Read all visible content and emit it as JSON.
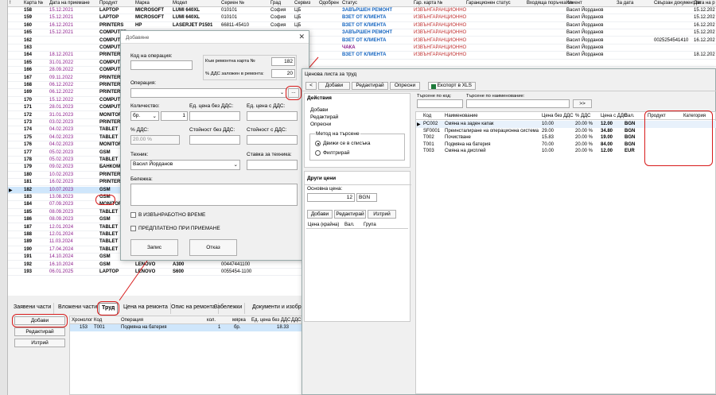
{
  "grid": {
    "headers": [
      "!",
      "Карта №",
      "Дата на приемане",
      "Продукт",
      "Марка",
      "Модел",
      "Сериен №",
      "Град",
      "Сервиз",
      "Одобрен",
      "Статус",
      "Гар. карта №",
      "Гаранционен статус",
      "Входяща поръчка №",
      "Клиент",
      "За дата",
      "Свързан документ №",
      "Дата на р"
    ],
    "rows": [
      {
        "n": "158",
        "d": "15.12.2021",
        "p": "LAPTOP",
        "m": "MICROSOFT",
        "mo": "LUMI 640XL",
        "s": "010101",
        "c": "София",
        "sv": "ЦБ",
        "st": "ЗАВЪРШЕН РЕМОНТ",
        "stc": "blue",
        "w": "ИЗВЪНГАРАНЦИОННО",
        "cl": "Васил Йорданов",
        "f": "",
        "dr": "15.12.202"
      },
      {
        "n": "159",
        "d": "15.12.2021",
        "p": "LAPTOP",
        "m": "MICROSOFT",
        "mo": "LUMI 640XL",
        "s": "010101",
        "c": "София",
        "sv": "ЦБ",
        "st": "ВЗЕТ ОТ КЛИЕНТА",
        "stc": "blue",
        "w": "ИЗВЪНГАРАНЦИОННО",
        "cl": "Васил Йорданов",
        "f": "",
        "dr": "15.12.202"
      },
      {
        "n": "160",
        "d": "16.12.2021",
        "p": "PRINTERS",
        "m": "HP",
        "mo": "LASERJET P1501",
        "s": "66811-45410",
        "c": "София",
        "sv": "ЦБ",
        "st": "ВЗЕТ ОТ КЛИЕНТА",
        "stc": "blue",
        "w": "ИЗВЪНГАРАНЦИОННО",
        "cl": "Васил Йорданов",
        "f": "",
        "dr": "16.12.202"
      },
      {
        "n": "165",
        "d": "15.12.2021",
        "p": "COMPUTER",
        "m": "",
        "mo": "",
        "s": "",
        "c": "",
        "sv": "",
        "st": "ЗАВЪРШЕН РЕМОНТ",
        "stc": "blue",
        "w": "ИЗВЪНГАРАНЦИОННО",
        "cl": "Васил Йорданов",
        "f": "",
        "dr": "15.12.202"
      },
      {
        "n": "162",
        "d": "",
        "p": "COMPUTER",
        "m": "",
        "mo": "",
        "s": "",
        "c": "",
        "sv": "",
        "st": "ВЗЕТ ОТ КЛИЕНТА",
        "stc": "blue",
        "w": "ИЗВЪНГАРАНЦИОННО",
        "cl": "Васил Йорданов",
        "f": "0025254541410",
        "dr": "16.12.202"
      },
      {
        "n": "163",
        "d": "",
        "p": "COMPUTER",
        "m": "",
        "mo": "",
        "s": "",
        "c": "",
        "sv": "",
        "st": "ЧАКА",
        "stc": "purple",
        "w": "ИЗВЪНГАРАНЦИОННО",
        "cl": "Васил Йорданов",
        "f": "",
        "dr": ""
      },
      {
        "n": "164",
        "d": "18.12.2021",
        "p": "PRINTER",
        "m": "",
        "mo": "",
        "s": "",
        "c": "",
        "sv": "",
        "st": "ВЗЕТ ОТ КЛИЕНТА",
        "stc": "blue",
        "w": "ИЗВЪНГАРАНЦИОННО",
        "cl": "Васил Йорданов",
        "f": "",
        "dr": "18.12.202"
      },
      {
        "n": "165",
        "d": "31.01.2022",
        "p": "COMPUTER",
        "m": "",
        "mo": "",
        "s": "",
        "c": "",
        "sv": "",
        "st": "",
        "stc": "blue",
        "w": "",
        "cl": "",
        "f": "",
        "dr": ""
      },
      {
        "n": "166",
        "d": "28.09.2022",
        "p": "COMPUTER",
        "m": "",
        "mo": "",
        "s": "",
        "c": "",
        "sv": "",
        "st": "",
        "stc": "blue",
        "w": "",
        "cl": "",
        "f": "",
        "dr": ""
      },
      {
        "n": "167",
        "d": "09.11.2022",
        "p": "PRINTER",
        "m": "",
        "mo": "",
        "s": "",
        "c": "",
        "sv": "",
        "st": "",
        "stc": "blue",
        "w": "",
        "cl": "",
        "f": "",
        "dr": ""
      },
      {
        "n": "168",
        "d": "06.12.2022",
        "p": "PRINTER",
        "m": "",
        "mo": "",
        "s": "",
        "c": "",
        "sv": "",
        "st": "",
        "stc": "blue",
        "w": "",
        "cl": "",
        "f": "",
        "dr": ""
      },
      {
        "n": "169",
        "d": "06.12.2022",
        "p": "PRINTER",
        "m": "",
        "mo": "",
        "s": "",
        "c": "",
        "sv": "",
        "st": "",
        "stc": "blue",
        "w": "",
        "cl": "",
        "f": "",
        "dr": ""
      },
      {
        "n": "170",
        "d": "15.12.2022",
        "p": "COMPUTER",
        "m": "",
        "mo": "",
        "s": "",
        "c": "",
        "sv": "",
        "st": "",
        "stc": "blue",
        "w": "",
        "cl": "",
        "f": "",
        "dr": ""
      },
      {
        "n": "171",
        "d": "28.01.2023",
        "p": "COMPUTER",
        "m": "",
        "mo": "",
        "s": "",
        "c": "",
        "sv": "",
        "st": "",
        "stc": "blue",
        "w": "",
        "cl": "",
        "f": "",
        "dr": ""
      },
      {
        "n": "172",
        "d": "31.01.2023",
        "p": "MONITOR",
        "m": "",
        "mo": "",
        "s": "",
        "c": "",
        "sv": "",
        "st": "",
        "stc": "blue",
        "w": "",
        "cl": "",
        "f": "",
        "dr": ""
      },
      {
        "n": "173",
        "d": "03.02.2023",
        "p": "PRINTER",
        "m": "",
        "mo": "",
        "s": "",
        "c": "",
        "sv": "",
        "st": "",
        "stc": "blue",
        "w": "",
        "cl": "",
        "f": "",
        "dr": ""
      },
      {
        "n": "174",
        "d": "04.02.2023",
        "p": "TABLET",
        "m": "",
        "mo": "",
        "s": "",
        "c": "",
        "sv": "",
        "st": "",
        "stc": "blue",
        "w": "",
        "cl": "",
        "f": "",
        "dr": ""
      },
      {
        "n": "175",
        "d": "04.02.2023",
        "p": "TABLET",
        "m": "",
        "mo": "",
        "s": "",
        "c": "",
        "sv": "",
        "st": "",
        "stc": "blue",
        "w": "",
        "cl": "",
        "f": "",
        "dr": ""
      },
      {
        "n": "176",
        "d": "04.02.2023",
        "p": "MONITOR",
        "m": "",
        "mo": "",
        "s": "",
        "c": "",
        "sv": "",
        "st": "",
        "stc": "blue",
        "w": "",
        "cl": "",
        "f": "",
        "dr": ""
      },
      {
        "n": "177",
        "d": "05.02.2023",
        "p": "GSM",
        "m": "",
        "mo": "",
        "s": "",
        "c": "",
        "sv": "",
        "st": "",
        "stc": "blue",
        "w": "",
        "cl": "",
        "f": "",
        "dr": ""
      },
      {
        "n": "178",
        "d": "05.02.2023",
        "p": "TABLET",
        "m": "",
        "mo": "",
        "s": "",
        "c": "",
        "sv": "",
        "st": "",
        "stc": "blue",
        "w": "",
        "cl": "",
        "f": "",
        "dr": ""
      },
      {
        "n": "179",
        "d": "09.02.2023",
        "p": "БАНКОМАТ",
        "m": "",
        "mo": "",
        "s": "",
        "c": "",
        "sv": "",
        "st": "",
        "stc": "blue",
        "w": "",
        "cl": "",
        "f": "",
        "dr": ""
      },
      {
        "n": "180",
        "d": "10.02.2023",
        "p": "PRINTER",
        "m": "",
        "mo": "",
        "s": "",
        "c": "",
        "sv": "",
        "st": "",
        "stc": "blue",
        "w": "",
        "cl": "",
        "f": "",
        "dr": ""
      },
      {
        "n": "181",
        "d": "16.02.2023",
        "p": "PRINTER",
        "m": "",
        "mo": "",
        "s": "",
        "c": "",
        "sv": "",
        "st": "",
        "stc": "blue",
        "w": "",
        "cl": "",
        "f": "",
        "dr": ""
      },
      {
        "n": "182",
        "d": "10.07.2023",
        "p": "GSM",
        "m": "",
        "mo": "",
        "s": "",
        "c": "",
        "sv": "",
        "st": "",
        "stc": "blue",
        "w": "",
        "cl": "",
        "f": "",
        "dr": ""
      },
      {
        "n": "183",
        "d": "13.08.2023",
        "p": "GSM",
        "m": "",
        "mo": "",
        "s": "",
        "c": "",
        "sv": "",
        "st": "",
        "stc": "blue",
        "w": "",
        "cl": "",
        "f": "",
        "dr": ""
      },
      {
        "n": "184",
        "d": "07.09.2023",
        "p": "MONITOR",
        "m": "",
        "mo": "",
        "s": "",
        "c": "",
        "sv": "",
        "st": "",
        "stc": "blue",
        "w": "",
        "cl": "",
        "f": "",
        "dr": ""
      },
      {
        "n": "185",
        "d": "08.09.2023",
        "p": "TABLET",
        "m": "",
        "mo": "",
        "s": "",
        "c": "",
        "sv": "",
        "st": "",
        "stc": "blue",
        "w": "",
        "cl": "",
        "f": "",
        "dr": ""
      },
      {
        "n": "186",
        "d": "08.09.2023",
        "p": "GSM",
        "m": "",
        "mo": "",
        "s": "",
        "c": "",
        "sv": "",
        "st": "",
        "stc": "blue",
        "w": "",
        "cl": "",
        "f": "",
        "dr": ""
      },
      {
        "n": "187",
        "d": "12.01.2024",
        "p": "TABLET",
        "m": "",
        "mo": "",
        "s": "",
        "c": "",
        "sv": "",
        "st": "",
        "stc": "blue",
        "w": "",
        "cl": "",
        "f": "",
        "dr": ""
      },
      {
        "n": "188",
        "d": "12.01.2024",
        "p": "TABLET",
        "m": "",
        "mo": "",
        "s": "",
        "c": "",
        "sv": "",
        "st": "",
        "stc": "blue",
        "w": "",
        "cl": "",
        "f": "",
        "dr": ""
      },
      {
        "n": "189",
        "d": "11.03.2024",
        "p": "TABLET",
        "m": "",
        "mo": "",
        "s": "",
        "c": "",
        "sv": "",
        "st": "",
        "stc": "blue",
        "w": "",
        "cl": "",
        "f": "",
        "dr": ""
      },
      {
        "n": "190",
        "d": "17.04.2024",
        "p": "TABLET",
        "m": "",
        "mo": "",
        "s": "",
        "c": "",
        "sv": "",
        "st": "",
        "stc": "blue",
        "w": "",
        "cl": "",
        "f": "",
        "dr": ""
      },
      {
        "n": "191",
        "d": "14.10.2024",
        "p": "GSM",
        "m": "",
        "mo": "",
        "s": "",
        "c": "",
        "sv": "",
        "st": "",
        "stc": "blue",
        "w": "",
        "cl": "",
        "f": "",
        "dr": ""
      },
      {
        "n": "192",
        "d": "16.10.2024",
        "p": "GSM",
        "m": "LENOVO",
        "mo": "A300",
        "s": "00447441100",
        "c": "",
        "sv": "",
        "st": "",
        "stc": "blue",
        "w": "",
        "cl": "",
        "f": "",
        "dr": ""
      },
      {
        "n": "193",
        "d": "06.01.2025",
        "p": "LAPTOP",
        "m": "LENOVO",
        "mo": "S600",
        "s": "0055454-1100",
        "c": "",
        "sv": "",
        "st": "",
        "stc": "blue",
        "w": "",
        "cl": "",
        "f": "",
        "dr": ""
      }
    ]
  },
  "bottom": {
    "tabs": [
      "Заявени части",
      "Вложени части",
      "Труд",
      "Цена на ремонта",
      "Опис на ремонта",
      "Забележки",
      "Документи и изобр"
    ],
    "add": "Добави",
    "edit": "Редактирай",
    "delete": "Изтрий",
    "headers": [
      "Хронолог",
      "Код",
      "Операция",
      "кол.",
      "мярка",
      "Ед. цена без ДДС",
      "ДДС"
    ],
    "row": [
      "153",
      "T001",
      "Подмяна на батерия",
      "1",
      "бр.",
      "18.33"
    ]
  },
  "dlg1": {
    "title": "Добавяне",
    "op_code": "Код на операция:",
    "card_lbl": "Към ремонтна карта №",
    "card_val": "182",
    "vat_lbl": "% ДДС заложен в ремонта:",
    "vat_val": "20",
    "operation": "Операция:",
    "qty": "Количество:",
    "unit": "бр.",
    "qty_val": "1",
    "price_no_vat": "Ед. цена без ДДС:",
    "price_vat": "Ед. цена с ДДС:",
    "vat_pct": "% ДДС:",
    "vat_pct_val": "20.00 %",
    "total_no_vat": "Стойност без ДДС:",
    "total_vat": "Стойност с ДДС:",
    "tech": "Техник:",
    "tech_val": "Васил Йорданов",
    "tech_rate": "Ставка за техника:",
    "note": "Бележка:",
    "overtime": "В ИЗВЪНРАБОТНО ВРЕМЕ",
    "prepaid": "ПРЕДПЛАТЕНО ПРИ ПРИЕМАНЕ",
    "save": "Запис",
    "cancel": "Отказ",
    "ellipsis": "..."
  },
  "dlg2": {
    "title": "Ценова листа за труд",
    "toolbar": [
      "Добави",
      "Редактирай",
      "Опресни",
      "Експорт в XLS"
    ],
    "back": "<",
    "actions": "Действия",
    "a_add": "Добави",
    "a_edit": "Редактирай",
    "a_refresh": "Опресни",
    "search_method": "Метод на търсене",
    "move_list": "Движи се в списъка",
    "filter": "Филтрирай",
    "other_prices": "Други цени",
    "base_price": "Основна цена:",
    "base_val": "12",
    "currency": "BGN",
    "b_add": "Добави",
    "b_edit": "Редактирай",
    "b_del": "Изтрий",
    "sub_headers": [
      "Цена (крайна)",
      "Вал.",
      "Група"
    ],
    "search_code": "Търсене по код:",
    "search_name": "Търсене по наименование:",
    "go": ">>",
    "headers": [
      "Код",
      "Наименование",
      "Цена без ДДС",
      "% ДДС",
      "Цена с ДДС",
      "Вал.",
      "Продукт",
      "Категория"
    ],
    "rows": [
      [
        "PC002",
        "Смяна на заден капак",
        "10.00",
        "20.00 %",
        "12.00",
        "BGN"
      ],
      [
        "SF0001",
        "Преинсталиране на операционна система",
        "29.00",
        "20.00 %",
        "34.80",
        "BGN"
      ],
      [
        "T002",
        "Почистване",
        "15.83",
        "20.00 %",
        "19.00",
        "BGN"
      ],
      [
        "T001",
        "Подмяна на батерия",
        "70.00",
        "20.00 %",
        "84.00",
        "BGN"
      ],
      [
        "T003",
        "Смяна на дисплей",
        "10.00",
        "20.00 %",
        "12.00",
        "EUR"
      ]
    ]
  }
}
